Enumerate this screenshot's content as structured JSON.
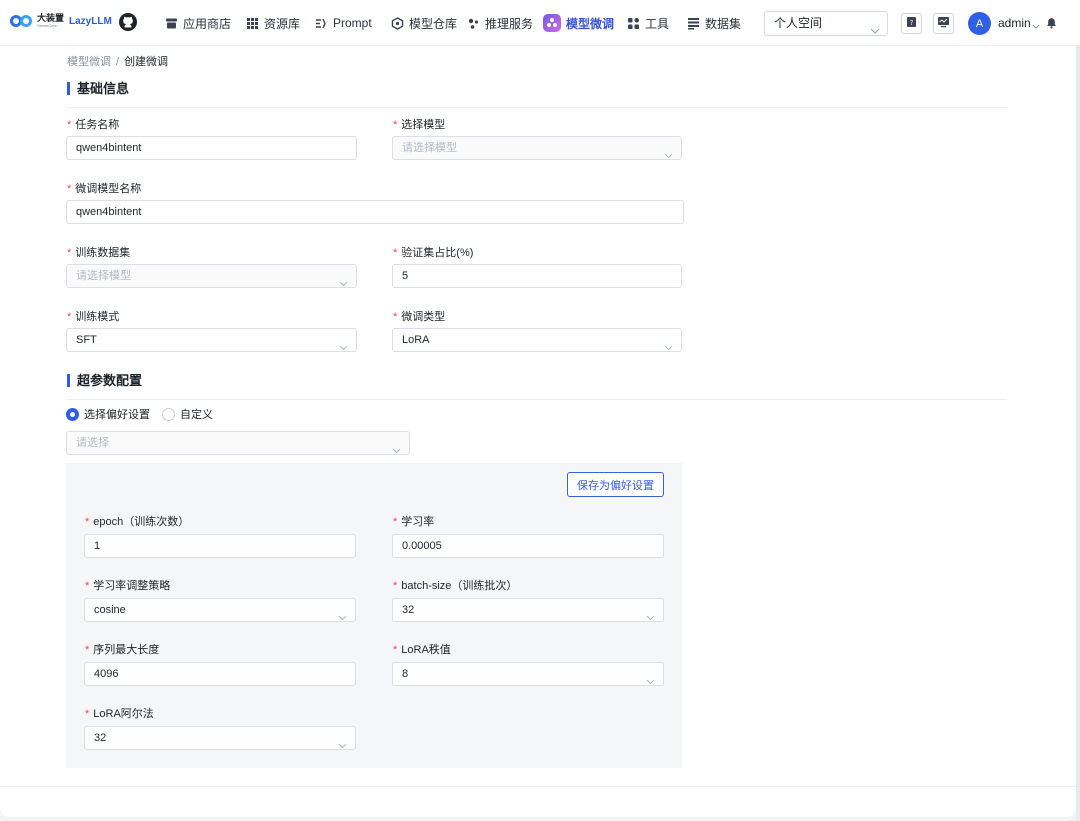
{
  "header": {
    "logo_cn": "大装置",
    "logo_sub": "SenseCore",
    "logo_product": "LazyLLM",
    "nav": [
      {
        "label": "应用商店",
        "icon": "store-icon"
      },
      {
        "label": "资源库",
        "icon": "grid-icon"
      },
      {
        "label": "Prompt",
        "icon": "prompt-icon"
      },
      {
        "label": "模型仓库",
        "icon": "model-warehouse-icon"
      },
      {
        "label": "推理服务",
        "icon": "inference-icon"
      },
      {
        "label": "模型微调",
        "icon": "finetune-icon",
        "active": true
      },
      {
        "label": "工具",
        "icon": "tools-icon"
      },
      {
        "label": "数据集",
        "icon": "dataset-icon"
      }
    ],
    "space_select": "个人空间",
    "avatar_letter": "A",
    "user_name": "admin"
  },
  "breadcrumb": {
    "parent": "模型微调",
    "separator": "/",
    "current": "创建微调"
  },
  "basic_section": {
    "title": "基础信息",
    "task_name": {
      "label": "任务名称",
      "value": "qwen4bintent"
    },
    "select_model": {
      "label": "选择模型",
      "placeholder": "请选择模型"
    },
    "finetuned_model_name": {
      "label": "微调模型名称",
      "value": "qwen4bintent"
    },
    "train_dataset": {
      "label": "训练数据集",
      "placeholder": "请选择模型"
    },
    "val_ratio": {
      "label": "验证集占比(%)",
      "value": "5"
    },
    "train_mode": {
      "label": "训练模式",
      "value": "SFT"
    },
    "finetune_type": {
      "label": "微调类型",
      "value": "LoRA"
    }
  },
  "hyper_section": {
    "title": "超参数配置",
    "radio_preference": "选择偏好设置",
    "radio_custom": "自定义",
    "preference_placeholder": "请选择",
    "save_pref_button": "保存为偏好设置",
    "epoch": {
      "label": "epoch（训练次数）",
      "value": "1"
    },
    "learning_rate": {
      "label": "学习率",
      "value": "0.00005"
    },
    "lr_scheduler": {
      "label": "学习率调整策略",
      "value": "cosine"
    },
    "batch_size": {
      "label": "batch-size（训练批次）",
      "value": "32"
    },
    "max_seq_len": {
      "label": "序列最大长度",
      "value": "4096"
    },
    "lora_rank": {
      "label": "LoRA秩值",
      "value": "8"
    },
    "lora_alpha": {
      "label": "LoRA阿尔法",
      "value": "32"
    }
  },
  "colors": {
    "accent": "#2f5fe6",
    "required": "#e84a4a",
    "panel_bg": "#f5f6f8"
  }
}
